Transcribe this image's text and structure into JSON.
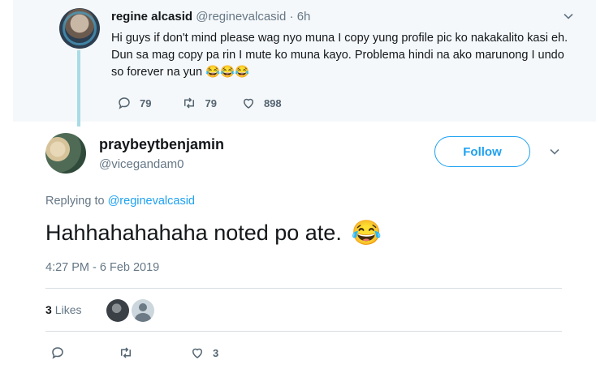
{
  "parent_tweet": {
    "name": "regine alcasid",
    "handle": "@reginevalcasid",
    "separator": "·",
    "time": "6h",
    "text": "Hi guys if don't mind please wag nyo muna I copy yung profile pic ko nakakalito kasi eh. Dun sa mag copy pa rin I mute ko muna kayo. Problema hindi na ako marunong I undo so forever na yun",
    "emojis": "😂😂😂",
    "reply_count": "79",
    "retweet_count": "79",
    "like_count": "898"
  },
  "main_tweet": {
    "name": "praybeytbenjamin",
    "handle": "@vicegandam0",
    "follow_label": "Follow",
    "replying_prefix": "Replying to",
    "replying_to": "@reginevalcasid",
    "text": "Hahhahahahaha noted po ate.",
    "emoji": "😂",
    "timestamp": "4:27 PM - 6 Feb 2019",
    "likes_number": "3",
    "likes_label": "Likes",
    "like_count": "3"
  },
  "colors": {
    "accent": "#1da1f2",
    "muted_text": "#657786",
    "thread_line": "#a8dbe6",
    "parent_bg": "#f5f8fa"
  },
  "icons": [
    "reply-icon",
    "retweet-icon",
    "like-icon",
    "chevron-down-icon"
  ]
}
